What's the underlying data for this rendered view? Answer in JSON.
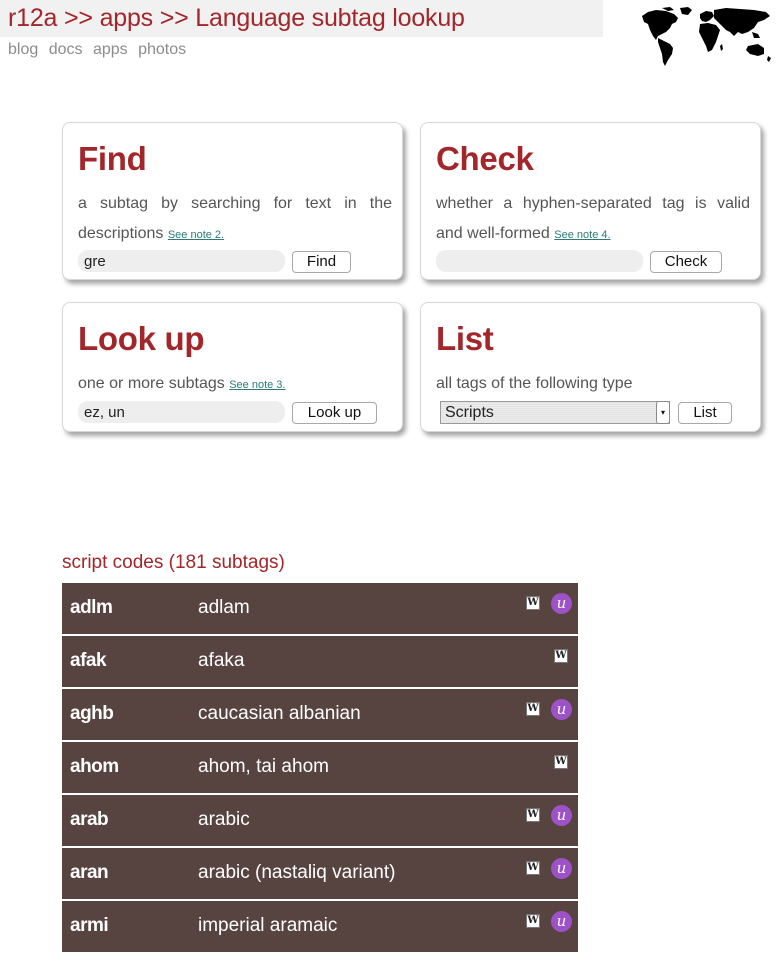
{
  "header": {
    "breadcrumbs": [
      "r12a",
      "apps",
      "Language subtag lookup"
    ],
    "separator": ">>",
    "nav": [
      "blog",
      "docs",
      "apps",
      "photos"
    ]
  },
  "cards": {
    "find": {
      "title": "Find",
      "desc": "a subtag by searching for text in the descriptions",
      "note": "See note 2.",
      "input_value": "gre",
      "button": "Find"
    },
    "check": {
      "title": "Check",
      "desc": "whether a hyphen-separated tag is valid and well-formed",
      "note": "See note 4.",
      "input_value": "",
      "button": "Check"
    },
    "lookup": {
      "title": "Look up",
      "desc": "one or more subtags",
      "note": "See note 3.",
      "input_value": "ez, un",
      "button": "Look up"
    },
    "list": {
      "title": "List",
      "desc": "all tags of the following type",
      "selected": "Scripts",
      "button": "List"
    }
  },
  "results": {
    "title": "script codes (181 subtags)",
    "rows": [
      {
        "code": "adlm",
        "name": "adlam",
        "wiki_icon": "W",
        "unicode_icon": "u"
      },
      {
        "code": "afak",
        "name": "afaka",
        "wiki_icon": "W"
      },
      {
        "code": "aghb",
        "name": "caucasian albanian",
        "wiki_icon": "W",
        "unicode_icon": "u"
      },
      {
        "code": "ahom",
        "name": "ahom, tai ahom",
        "wiki_icon": "W"
      },
      {
        "code": "arab",
        "name": "arabic",
        "wiki_icon": "W",
        "unicode_icon": "u"
      },
      {
        "code": "aran",
        "name": "arabic (nastaliq variant)",
        "wiki_icon": "W",
        "unicode_icon": "u"
      },
      {
        "code": "armi",
        "name": "imperial aramaic",
        "wiki_icon": "W",
        "unicode_icon": "u"
      }
    ]
  },
  "colors": {
    "accent": "#a2262a",
    "row_bg": "#574441",
    "unicode_badge": "#9e52c8",
    "note_link": "#2a7a7a"
  },
  "icons": [
    "world-map-icon",
    "wikipedia-icon",
    "unicode-icon",
    "chevron-down-icon"
  ]
}
